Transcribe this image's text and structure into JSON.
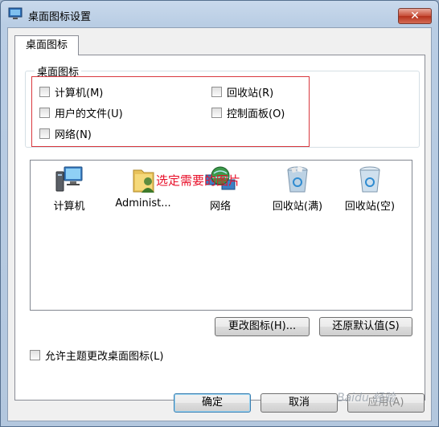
{
  "window": {
    "title": "桌面图标设置",
    "close_label": "✕"
  },
  "tabs": [
    {
      "label": "桌面图标"
    }
  ],
  "group": {
    "label": "桌面图标",
    "checkboxes": [
      {
        "label": "计算机(M)",
        "checked": false
      },
      {
        "label": "回收站(R)",
        "checked": false
      },
      {
        "label": "用户的文件(U)",
        "checked": false
      },
      {
        "label": "控制面板(O)",
        "checked": false
      },
      {
        "label": "网络(N)",
        "checked": false
      }
    ]
  },
  "icons": [
    {
      "label": "计算机",
      "icon": "computer-icon"
    },
    {
      "label": "Administ...",
      "icon": "user-folder-icon"
    },
    {
      "label": "网络",
      "icon": "network-globe-icon"
    },
    {
      "label": "回收站(满)",
      "icon": "recycle-bin-full-icon"
    },
    {
      "label": "回收站(空)",
      "icon": "recycle-bin-empty-icon"
    }
  ],
  "annotation": "选定需要的图片",
  "buttons": {
    "change_icon": "更改图标(H)...",
    "restore_default": "还原默认值(S)",
    "ok": "确定",
    "cancel": "取消",
    "apply": "应用(A)"
  },
  "theme_checkbox": {
    "label": "允许主题更改桌面图标(L)",
    "checked": false
  },
  "watermark": "Baidu 经验",
  "colors": {
    "annotation": "#e8102a",
    "highlight_box": "#d9383e"
  }
}
